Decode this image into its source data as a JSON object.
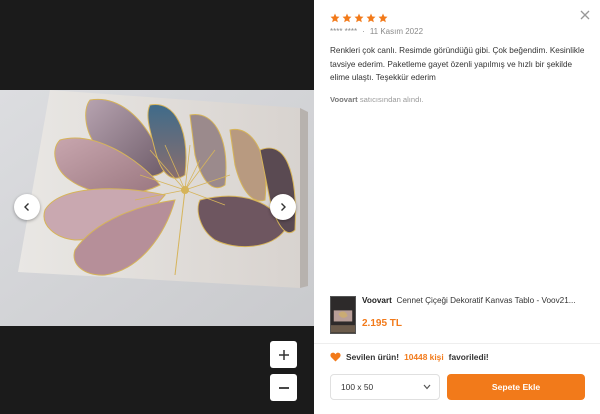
{
  "gallery": {
    "image_alt_icon": "flower-canvas-photo",
    "prev_icon": "chevron-left-icon",
    "next_icon": "chevron-right-icon",
    "zoom_in_icon": "plus-icon",
    "zoom_out_icon": "minus-icon"
  },
  "review": {
    "rating": 5,
    "max_rating": 5,
    "reviewer": "**** ****",
    "separator": "·",
    "date": "11 Kasım 2022",
    "text": "Renkleri çok canlı. Resimde göründüğü gibi. Çok beğendim. Kesinlikle tavsiye ederim. Paketleme gayet özenli yapılmış ve hızlı bir şekilde elime ulaştı. Teşekkür ederim",
    "seller_name": "Voovart",
    "seller_suffix": "satıcısından alındı."
  },
  "product": {
    "brand": "Voovart",
    "name": "Cennet Çiçeği Dekoratif Kanvas Tablo - Voov21...",
    "price": "2.195 TL"
  },
  "favorite": {
    "prefix": "Sevilen ürün!",
    "count": "10448 kişi",
    "suffix": "favoriledi!"
  },
  "size_select": {
    "selected": "100 x 50"
  },
  "cart_button": {
    "label": "Sepete Ekle"
  },
  "colors": {
    "accent": "#f27a1a",
    "star": "#f27a1a",
    "dark_bg": "#1b1b1b"
  }
}
